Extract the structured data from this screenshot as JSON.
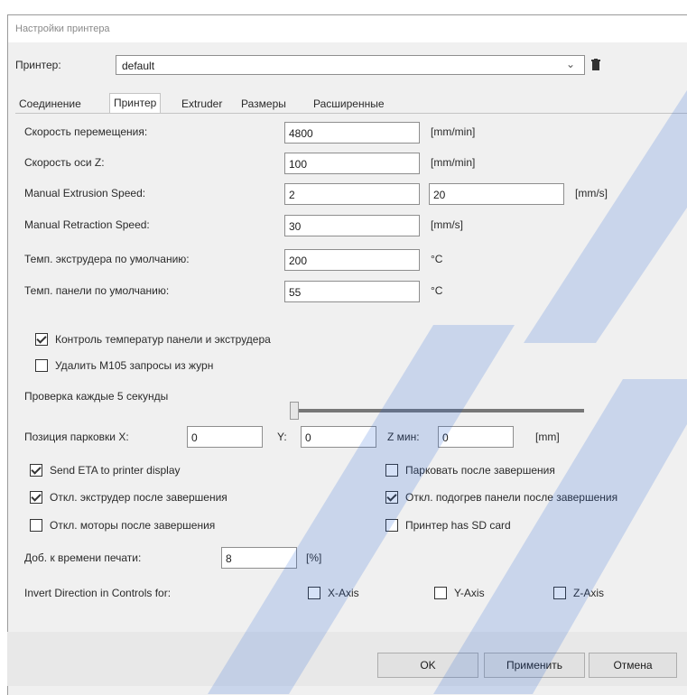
{
  "window": {
    "title": "Настройки принтера"
  },
  "printer": {
    "label": "Принтер:",
    "selected": "default"
  },
  "tabs": [
    {
      "label": "Соединение"
    },
    {
      "label": "Принтер"
    },
    {
      "label": "Extruder"
    },
    {
      "label": "Размеры"
    },
    {
      "label": "Расширенные"
    }
  ],
  "fields": {
    "travel_speed": {
      "label": "Скорость перемещения:",
      "value": "4800",
      "unit": "[mm/min]"
    },
    "z_speed": {
      "label": "Скорость оси Z:",
      "value": "100",
      "unit": "[mm/min]"
    },
    "manual_extrusion": {
      "label": "Manual Extrusion Speed:",
      "value1": "2",
      "value2": "20",
      "unit": "[mm/s]"
    },
    "manual_retraction": {
      "label": "Manual Retraction Speed:",
      "value": "30",
      "unit": "[mm/s]"
    },
    "extruder_temp": {
      "label": "Темп. экструдера по умолчанию:",
      "value": "200",
      "unit": "°C"
    },
    "bed_temp": {
      "label": "Темп. панели по умолчанию:",
      "value": "55",
      "unit": "°C"
    }
  },
  "checks": {
    "temp_control": {
      "label": "Контроль температур панели и экструдера",
      "checked": true
    },
    "remove_m105": {
      "label": "Удалить M105 запросы из журн",
      "checked": false
    }
  },
  "slider": {
    "label": "Проверка каждые 5 секунды"
  },
  "park": {
    "label": "Позиция парковки X:",
    "x": "0",
    "y_label": "Y:",
    "y": "0",
    "zmin_label": "Z мин:",
    "zmin": "0",
    "unit": "[mm]"
  },
  "options": {
    "send_eta": {
      "label": "Send ETA to printer display",
      "checked": true
    },
    "park_after": {
      "label": "Парковать после завершения",
      "checked": false
    },
    "disable_extruder": {
      "label": "Откл. экструдер после завершения",
      "checked": true
    },
    "disable_heatbed": {
      "label": "Откл. подогрев панели после завершения",
      "checked": true
    },
    "disable_motors": {
      "label": "Откл. моторы после завершения",
      "checked": false
    },
    "printer_sd": {
      "label": "Принтер has SD card",
      "checked": false
    }
  },
  "print_time": {
    "label": "Доб. к времени печати:",
    "value": "8",
    "unit": "[%]"
  },
  "invert": {
    "label": "Invert Direction in Controls for:",
    "x": {
      "label": "X-Axis",
      "checked": false
    },
    "y": {
      "label": "Y-Axis",
      "checked": false
    },
    "z": {
      "label": "Z-Axis",
      "checked": false
    }
  },
  "buttons": {
    "ok": "OK",
    "apply": "Применить",
    "cancel": "Отмена"
  },
  "colors": {
    "watermark": "#1e5fd6",
    "window_bg": "#f0f0f0"
  }
}
